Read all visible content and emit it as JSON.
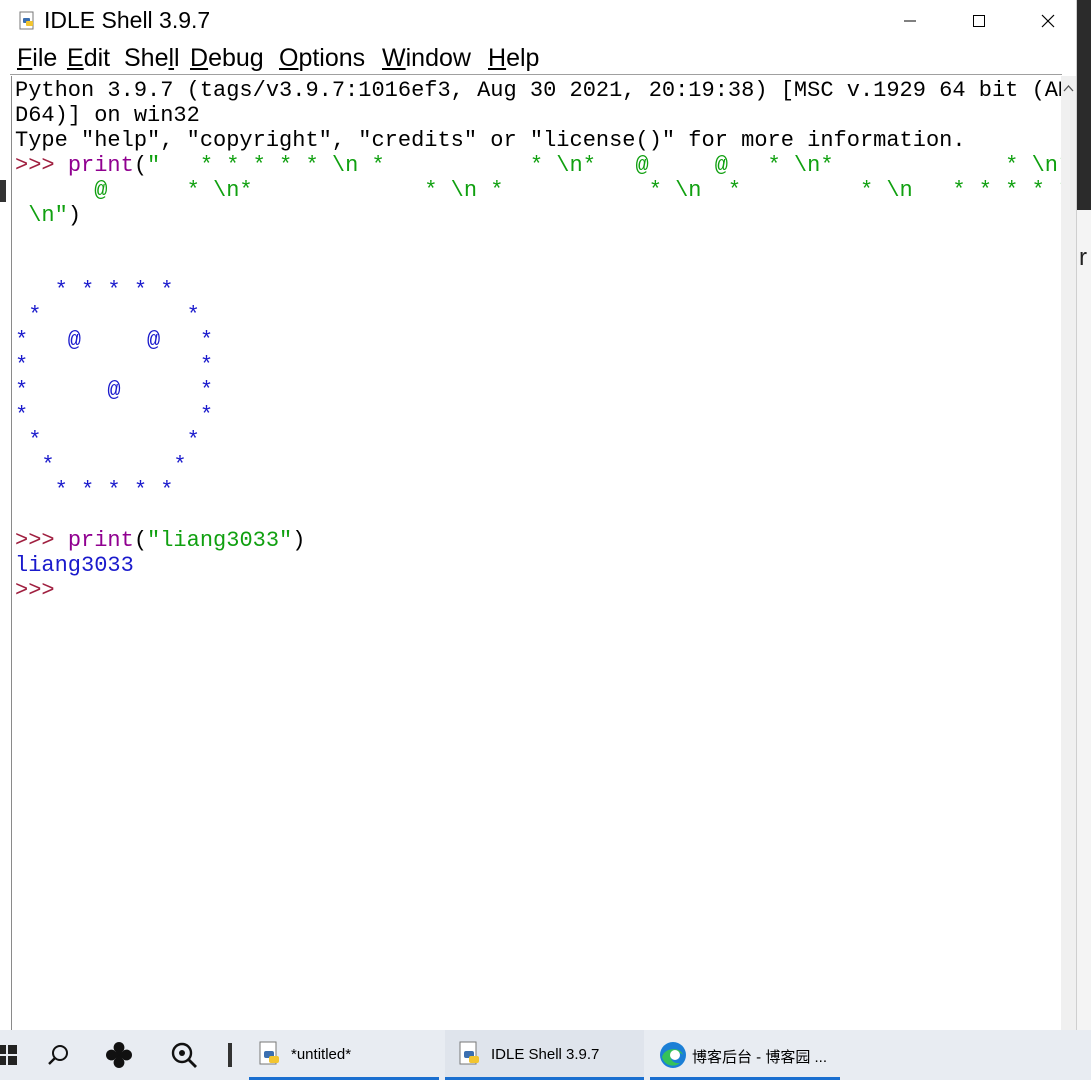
{
  "window": {
    "title": "IDLE Shell 3.9.7",
    "title_icon": "python-idle-icon",
    "controls": {
      "minimize_icon": "minimize-icon",
      "maximize_icon": "maximize-icon",
      "close_icon": "close-icon"
    }
  },
  "menu": {
    "items": [
      {
        "label": "File",
        "accel": "F",
        "rest": "ile"
      },
      {
        "label": "Edit",
        "accel": "E",
        "rest": "dit"
      },
      {
        "label": "Shell",
        "accel": "",
        "rest": "Shell"
      },
      {
        "label": "Debug",
        "accel": "D",
        "rest": "ebug"
      },
      {
        "label": "Options",
        "accel": "O",
        "rest": "ptions"
      },
      {
        "label": "Window",
        "accel": "W",
        "rest": "indow"
      },
      {
        "label": "Help",
        "accel": "H",
        "rest": "elp"
      }
    ]
  },
  "shell": {
    "banner_1": "Python 3.9.7 (tags/v3.9.7:1016ef3, Aug 30 2021, 20:19:38) [MSC v.1929 64 bit (AM",
    "banner_2": "D64)] on win32",
    "banner_3": "Type \"help\", \"copyright\", \"credits\" or \"license()\" for more information.",
    "prompt": ">>> ",
    "cmd1_kw": "print",
    "cmd1_open": "(",
    "cmd1_str_1": "\"   * * * * * \\n *           * \\n*   @     @   * \\n*             * \\n*",
    "cmd1_str_2": "      @      * \\n*             * \\n *           * \\n  *         * \\n   * * * * *",
    "cmd1_str_3": " \\n\"",
    "cmd1_close": ")",
    "output1": [
      "",
      "",
      "",
      "   * * * * *",
      " *           *",
      "*   @     @   *",
      "*             *",
      "*      @      *",
      "*             *",
      " *           *",
      "  *         *",
      "   * * * * *",
      ""
    ],
    "cmd2_kw": "print",
    "cmd2_open": "(",
    "cmd2_str": "\"liang3033\"",
    "cmd2_close": ")",
    "output2": "liang3033",
    "prompt_last": ">>> "
  },
  "taskbar": {
    "start_icon": "windows-start-icon",
    "search_icon": "search-icon",
    "task_view_icon": "app-icon",
    "search2_icon": "magnifier-icon",
    "apps": [
      {
        "label": "*untitled*",
        "icon": "python-idle-icon"
      },
      {
        "label": "IDLE Shell 3.9.7",
        "icon": "python-idle-icon"
      },
      {
        "label": "博客后台 - 博客园 ...",
        "icon": "edge-browser-icon"
      }
    ]
  },
  "colors": {
    "prompt": "#a02040",
    "keyword": "#900090",
    "string": "#10a010",
    "output": "#1a1acc",
    "taskbar_accent": "#1a6fd0"
  }
}
